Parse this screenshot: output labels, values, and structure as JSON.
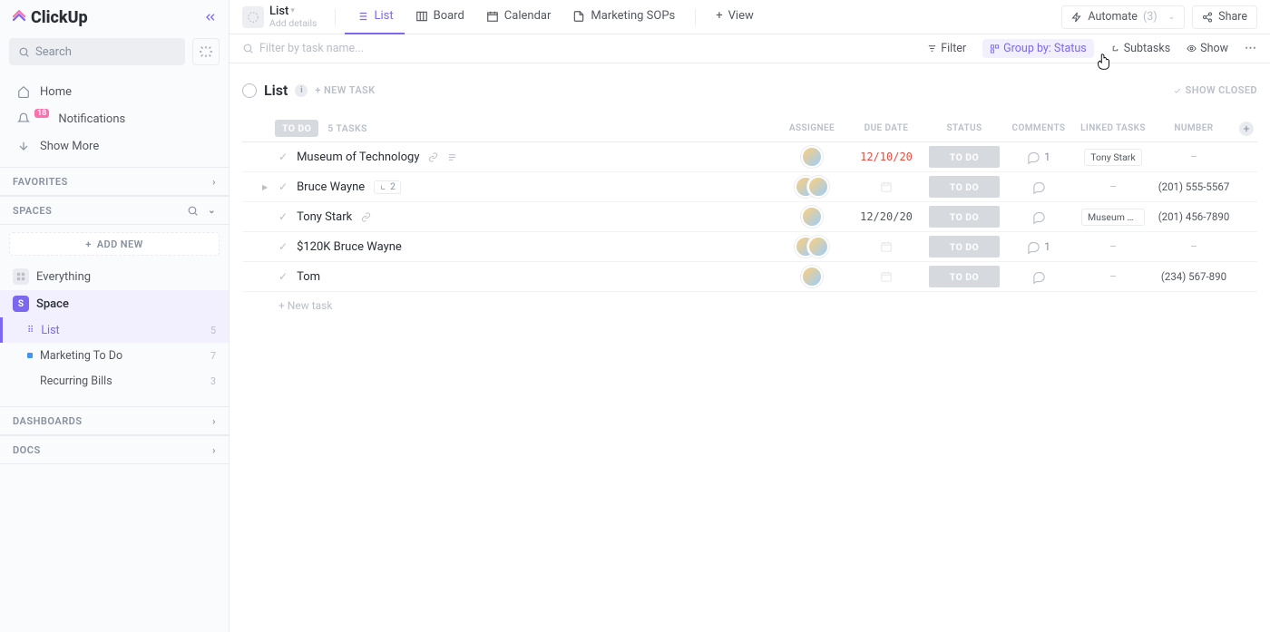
{
  "brand": "ClickUp",
  "sidebar": {
    "search_placeholder": "Search",
    "nav": {
      "home": "Home",
      "notifications": "Notifications",
      "notif_badge": "18",
      "show_more": "Show More"
    },
    "favorites_hdr": "FAVORITES",
    "spaces_hdr": "SPACES",
    "add_new": "ADD NEW",
    "everything": "Everything",
    "space": "Space",
    "lists": [
      {
        "label": "List",
        "count": "5",
        "active": true,
        "dot": "bullet"
      },
      {
        "label": "Marketing To Do",
        "count": "7",
        "dot": "blue"
      },
      {
        "label": "Recurring Bills",
        "count": "3",
        "dot": "plain"
      }
    ],
    "dashboards_hdr": "DASHBOARDS",
    "docs_hdr": "DOCS"
  },
  "header": {
    "loc_title": "List",
    "loc_sub": "Add details",
    "views": [
      {
        "label": "List",
        "active": true,
        "icon": "list"
      },
      {
        "label": "Board",
        "icon": "board"
      },
      {
        "label": "Calendar",
        "icon": "calendar"
      },
      {
        "label": "Marketing SOPs",
        "icon": "doc"
      }
    ],
    "add_view": "View",
    "automate": "Automate",
    "automate_count": "(3)",
    "share": "Share"
  },
  "toolbar": {
    "filter_placeholder": "Filter by task name...",
    "filter": "Filter",
    "group_by": "Group by: Status",
    "subtasks": "Subtasks",
    "show": "Show"
  },
  "list_area": {
    "title": "List",
    "new_task_btn": "+ NEW TASK",
    "show_closed": "SHOW CLOSED",
    "group_status": "TO DO",
    "task_count": "5 TASKS",
    "columns": {
      "assignee": "ASSIGNEE",
      "due": "DUE DATE",
      "status": "STATUS",
      "comments": "COMMENTS",
      "linked": "LINKED TASKS",
      "number": "NUMBER"
    },
    "tasks": [
      {
        "title": "Museum of Technology",
        "link": true,
        "desc": true,
        "due": "12/10/20",
        "due_red": true,
        "status": "TO DO",
        "comments": "1",
        "linked": "Tony Stark",
        "number": "–",
        "avatars": 1
      },
      {
        "title": "Bruce Wayne",
        "caret": true,
        "sub": "2",
        "status": "TO DO",
        "linked": "–",
        "number": "(201) 555-5567",
        "avatars": 2
      },
      {
        "title": "Tony Stark",
        "link": true,
        "due": "12/20/20",
        "status": "TO DO",
        "linked": "Museum of …",
        "number": "(201) 456-7890",
        "avatars": 1
      },
      {
        "title": "$120K Bruce Wayne",
        "status": "TO DO",
        "comments": "1",
        "linked": "–",
        "number": "–",
        "avatars": 2
      },
      {
        "title": "Tom",
        "status": "TO DO",
        "linked": "–",
        "number": "(234) 567-890",
        "avatars": 1
      }
    ],
    "new_task_row": "+ New task"
  }
}
